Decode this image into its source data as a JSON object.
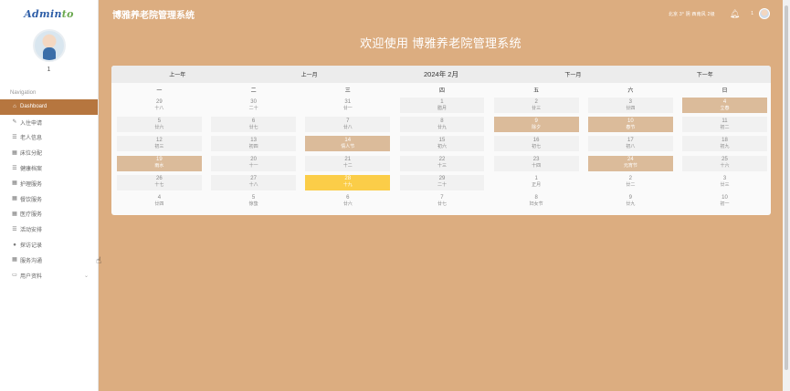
{
  "sidebar": {
    "brand": "Admin",
    "brand_accent": "to",
    "user": "1",
    "nav_title": "Navigation",
    "items": [
      {
        "label": "Dashboard",
        "icon": "home-icon",
        "glyph": "⌂"
      },
      {
        "label": "入住申请",
        "icon": "pen-icon",
        "glyph": "✎"
      },
      {
        "label": "老人信息",
        "icon": "list-icon",
        "glyph": "☰"
      },
      {
        "label": "床位分配",
        "icon": "grid-icon",
        "glyph": "▦"
      },
      {
        "label": "健康档案",
        "icon": "list-icon",
        "glyph": "☰"
      },
      {
        "label": "护理服务",
        "icon": "grid-icon",
        "glyph": "▦"
      },
      {
        "label": "餐饮服务",
        "icon": "grid-icon",
        "glyph": "▦"
      },
      {
        "label": "医疗服务",
        "icon": "grid-icon",
        "glyph": "▦"
      },
      {
        "label": "活动安排",
        "icon": "list-icon",
        "glyph": "☰"
      },
      {
        "label": "探访记录",
        "icon": "user-icon",
        "glyph": "●"
      },
      {
        "label": "服务沟通",
        "icon": "grid-icon",
        "glyph": "▦"
      },
      {
        "label": "用户资料",
        "icon": "window-icon",
        "glyph": "▭"
      }
    ]
  },
  "header": {
    "title": "博雅养老院管理系统",
    "weather": "北京  3°  阴  西南风  2级",
    "user": "1"
  },
  "welcome": "欢迎使用 博雅养老院管理系统",
  "calendar": {
    "prev_year": "上一年",
    "prev_month": "上一月",
    "month": "2024年 2月",
    "next_month": "下一月",
    "next_year": "下一年",
    "weekdays": [
      "一",
      "二",
      "三",
      "四",
      "五",
      "六",
      "日"
    ],
    "days": [
      {
        "n": "29",
        "l": "十八",
        "t": "out"
      },
      {
        "n": "30",
        "l": "二十",
        "t": "out"
      },
      {
        "n": "31",
        "l": "廿一",
        "t": "out"
      },
      {
        "n": "1",
        "l": "腊月",
        "t": ""
      },
      {
        "n": "2",
        "l": "廿三",
        "t": ""
      },
      {
        "n": "3",
        "l": "廿四",
        "t": ""
      },
      {
        "n": "4",
        "l": "立春",
        "t": "hol"
      },
      {
        "n": "5",
        "l": "廿六",
        "t": ""
      },
      {
        "n": "6",
        "l": "廿七",
        "t": ""
      },
      {
        "n": "7",
        "l": "廿八",
        "t": ""
      },
      {
        "n": "8",
        "l": "廿九",
        "t": ""
      },
      {
        "n": "9",
        "l": "除夕",
        "t": "hol"
      },
      {
        "n": "10",
        "l": "春节",
        "t": "hol"
      },
      {
        "n": "11",
        "l": "初二",
        "t": ""
      },
      {
        "n": "12",
        "l": "初三",
        "t": ""
      },
      {
        "n": "13",
        "l": "初四",
        "t": ""
      },
      {
        "n": "14",
        "l": "情人节",
        "t": "hol"
      },
      {
        "n": "15",
        "l": "初六",
        "t": ""
      },
      {
        "n": "16",
        "l": "初七",
        "t": ""
      },
      {
        "n": "17",
        "l": "初八",
        "t": ""
      },
      {
        "n": "18",
        "l": "初九",
        "t": ""
      },
      {
        "n": "19",
        "l": "雨水",
        "t": "hol"
      },
      {
        "n": "20",
        "l": "十一",
        "t": ""
      },
      {
        "n": "21",
        "l": "十二",
        "t": ""
      },
      {
        "n": "22",
        "l": "十三",
        "t": ""
      },
      {
        "n": "23",
        "l": "十四",
        "t": ""
      },
      {
        "n": "24",
        "l": "元宵节",
        "t": "hol"
      },
      {
        "n": "25",
        "l": "十六",
        "t": ""
      },
      {
        "n": "26",
        "l": "十七",
        "t": ""
      },
      {
        "n": "27",
        "l": "十八",
        "t": ""
      },
      {
        "n": "28",
        "l": "十九",
        "t": "today"
      },
      {
        "n": "29",
        "l": "二十",
        "t": ""
      },
      {
        "n": "1",
        "l": "正月",
        "t": "out"
      },
      {
        "n": "2",
        "l": "廿二",
        "t": "out"
      },
      {
        "n": "3",
        "l": "廿三",
        "t": "out"
      },
      {
        "n": "4",
        "l": "廿四",
        "t": "out"
      },
      {
        "n": "5",
        "l": "惊蛰",
        "t": "out"
      },
      {
        "n": "6",
        "l": "廿六",
        "t": "out"
      },
      {
        "n": "7",
        "l": "廿七",
        "t": "out"
      },
      {
        "n": "8",
        "l": "妇女节",
        "t": "out"
      },
      {
        "n": "9",
        "l": "廿九",
        "t": "out"
      },
      {
        "n": "10",
        "l": "初一",
        "t": "out"
      }
    ]
  },
  "colors": {
    "page_bg": "#dcad80",
    "active_nav": "#b6763f",
    "holiday": "#dbbb9a",
    "today": "#fbcd48"
  }
}
